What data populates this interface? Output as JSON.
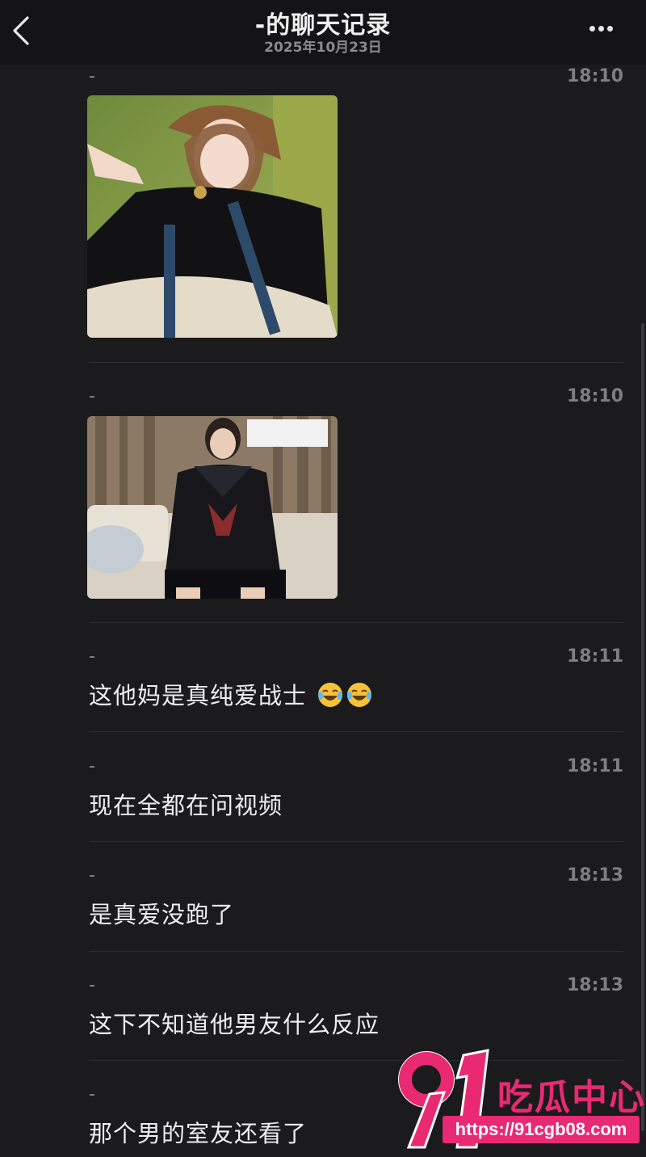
{
  "header": {
    "title": "-的聊天记录",
    "date": "2025年10月23日"
  },
  "messages": [
    {
      "sender": "-",
      "time": "18:10",
      "type": "image",
      "image": "photo-girl-beret-grass"
    },
    {
      "sender": "-",
      "time": "18:10",
      "type": "image",
      "image": "photo-girl-sailor-uniform-sofa"
    },
    {
      "sender": "-",
      "time": "18:11",
      "type": "text",
      "text": "这他妈是真纯爱战士",
      "emoji": [
        "laughing-tears-emoji",
        "laughing-tears-emoji"
      ]
    },
    {
      "sender": "-",
      "time": "18:11",
      "type": "text",
      "text": "现在全都在问视频"
    },
    {
      "sender": "-",
      "time": "18:13",
      "type": "text",
      "text": "是真爱没跑了"
    },
    {
      "sender": "-",
      "time": "18:13",
      "type": "text",
      "text": "这下不知道他男友什么反应"
    },
    {
      "sender": "-",
      "time": "",
      "type": "text",
      "text": "那个男的室友还看了"
    }
  ],
  "watermark": {
    "logo": "91",
    "name": "吃瓜中心",
    "url": "https://91cgb08.com",
    "color": "#e92a73"
  }
}
